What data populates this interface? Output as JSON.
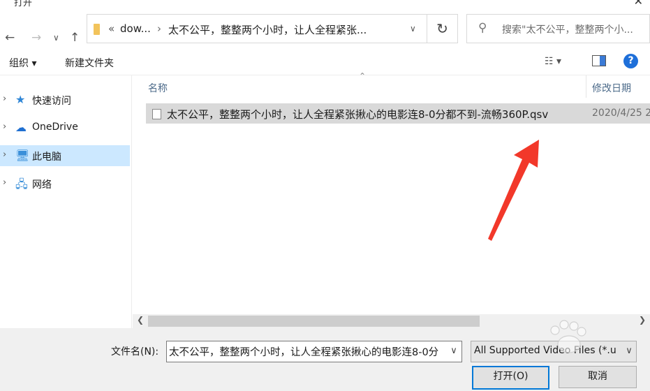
{
  "window": {
    "title": "打开",
    "close_icon": "close-icon"
  },
  "nav": {
    "back_icon": "back-arrow-icon",
    "forward_icon": "forward-arrow-icon",
    "recent_icon": "chevron-down-icon",
    "up_icon": "up-arrow-icon",
    "address": {
      "prefix": "«",
      "segment1": "dow...",
      "sep": "›",
      "segment2": "太不公平，整整两个小时，让人全程紧张..."
    },
    "search_placeholder": "搜索\"太不公平，整整两个小...",
    "refresh_icon": "refresh-icon",
    "search_icon": "search-icon"
  },
  "toolbar": {
    "organize": "组织 ▾",
    "new_folder": "新建文件夹",
    "view_icon": "view-options-icon",
    "preview_icon": "preview-pane-icon",
    "help_icon": "help-icon",
    "help_label": "?"
  },
  "sidebar": {
    "items": [
      {
        "label": "快速访问",
        "icon": "star-icon",
        "selected": false
      },
      {
        "label": "OneDrive",
        "icon": "cloud-icon",
        "selected": false
      },
      {
        "label": "此电脑",
        "icon": "computer-icon",
        "selected": true
      },
      {
        "label": "网络",
        "icon": "network-icon",
        "selected": false
      }
    ]
  },
  "list": {
    "columns": {
      "name": "名称",
      "date": "修改日期"
    },
    "files": [
      {
        "name": "太不公平，整整两个小时，让人全程紧张揪心的电影连8-0分都不到-流畅360P.qsv",
        "date": "2020/4/25 2"
      }
    ]
  },
  "footer": {
    "filename_label": "文件名(N):",
    "filename_value": "太不公平，整整两个小时，让人全程紧张揪心的电影连8-0分",
    "filetype_value": "All Supported Video Files (*.u",
    "open_button": "打开(O)",
    "cancel_button": "取消"
  },
  "colors": {
    "selection": "#cce8ff",
    "accent": "#0078d7",
    "annotation_arrow": "#f2382a"
  }
}
